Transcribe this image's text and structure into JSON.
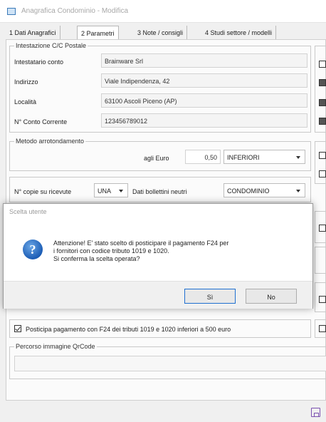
{
  "window": {
    "title": "Anagrafica Condominio - Modifica"
  },
  "tabs": [
    {
      "label": "1 Dati Anagrafici"
    },
    {
      "label": "2 Parametri"
    },
    {
      "label": "3 Note / consigli"
    },
    {
      "label": "4 Studi settore / modelli"
    }
  ],
  "postal": {
    "legend": "Intestazione C/C Postale",
    "rows": [
      {
        "label": "Intestatario conto",
        "value": "Brainware Srl"
      },
      {
        "label": "Indirizzo",
        "value": "Viale Indipendenza, 42"
      },
      {
        "label": "Località",
        "value": "63100 Ascoli Piceno (AP)"
      },
      {
        "label": "N° Conto Corrente",
        "value": "123456789012"
      }
    ]
  },
  "rounding": {
    "legend": "Metodo arrotondamento",
    "euro_label": "agli Euro",
    "euro_value": "0,50",
    "mode_value": "INFERIORI"
  },
  "receipts": {
    "copies_label": "N° copie su ricevute",
    "copies_value": "UNA",
    "neutral_label": "Dati bollettini neutri",
    "neutral_value": "CONDOMINIO"
  },
  "dialog": {
    "title": "Scelta utente",
    "message_line1": "Attenzione! E' stato scelto di posticipare il pagamento F24 per",
    "message_line2": "i fornitori con codice tributo 1019 e 1020.",
    "message_line3": "Si conferma la scelta operata?",
    "yes_label": "Sì",
    "no_label": "No"
  },
  "postpone": {
    "label": "Posticipa pagamento con F24 dei tributi 1019 e 1020 inferiori a 500 euro",
    "checked": true
  },
  "qrcode": {
    "legend": "Percorso immagine QrCode",
    "value": ""
  },
  "colors": {
    "accent": "#1f6fd0",
    "save_icon": "#7a4fb0"
  }
}
